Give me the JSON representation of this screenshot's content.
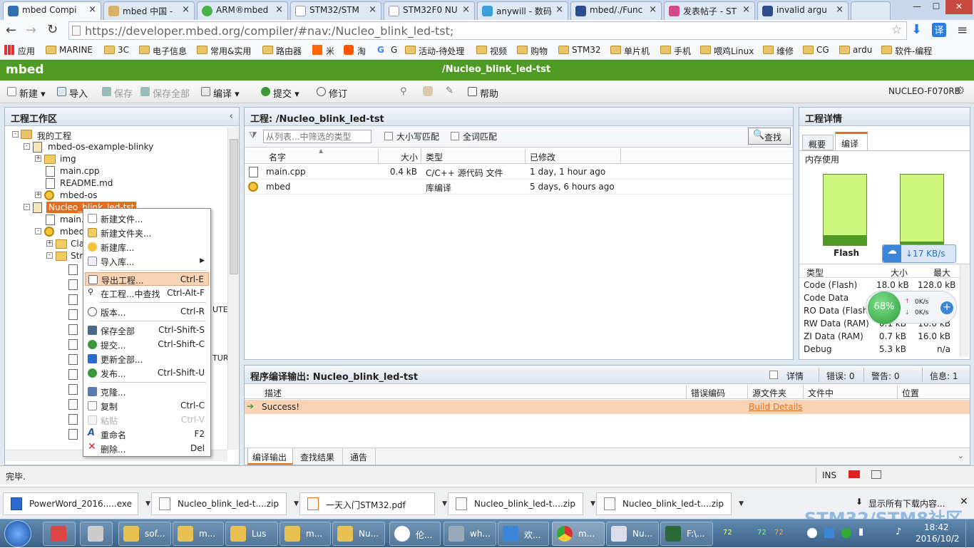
{
  "browser": {
    "tabs": [
      {
        "title": "mbed Compi",
        "color": "#2f6fb3",
        "active": true
      },
      {
        "title": "mbed 中国 -",
        "color": "#d9b26a"
      },
      {
        "title": "ARM®mbed",
        "color": "#49b34a"
      },
      {
        "title": "STM32/STM",
        "color": "#ffffff"
      },
      {
        "title": "STM32F0 NU",
        "color": "#ffffff"
      },
      {
        "title": "anywill - 数码",
        "color": "#3ca0d8"
      },
      {
        "title": "mbed/./Func",
        "color": "#2d4d8e"
      },
      {
        "title": "发表帖子 - ST",
        "color": "#d04a8a"
      },
      {
        "title": "invalid argu",
        "color": "#2d4d8e"
      }
    ],
    "window_controls": [
      "—",
      "☐",
      "✕"
    ],
    "url": "https://developer.mbed.org/compiler/#nav:/Nucleo_blink_led-tst;",
    "bookmarks": [
      "应用",
      "MARINE",
      "3C",
      "电子信息",
      "常用&实用",
      "路由器",
      "米",
      "淘",
      "G",
      "活动-待处理",
      "视频",
      "购物",
      "STM32",
      "单片机",
      "手机",
      "喂鸡Linux",
      "维修",
      "CG",
      "ardu",
      "软件-编程"
    ]
  },
  "app": {
    "logo": "mbed",
    "title": "/Nucleo_blink_led-tst",
    "platform": "NUCLEO-F070RB",
    "toolbar": {
      "new": "新建",
      "import": "导入",
      "save": "保存",
      "save_all": "保存全部",
      "compile": "编译",
      "commit": "提交",
      "revise": "修订",
      "help": "帮助"
    }
  },
  "workspace": {
    "title": "工程工作区",
    "collapse_glyph": "‹",
    "tree": {
      "root": "我的工程",
      "project1": "mbed-os-example-blinky",
      "img": "img",
      "main_cpp": "main.cpp",
      "readme": "README.md",
      "mbed_os": "mbed-os",
      "project2": "Nucleo_blink_led-tst",
      "main_cpp2": "main.cpp",
      "mbed": "mbed",
      "cla": "Cla",
      "stru": "Stru",
      "frag1": "UTES",
      "frag2": "TURE"
    }
  },
  "context_menu": {
    "items": [
      {
        "label": "新建文件...",
        "shortcut": ""
      },
      {
        "label": "新建文件夹...",
        "shortcut": ""
      },
      {
        "label": "新建库...",
        "shortcut": ""
      },
      {
        "label": "导入库...",
        "shortcut": "▶"
      },
      {
        "label": "导出工程...",
        "shortcut": "Ctrl-E"
      },
      {
        "label": "在工程...中查找",
        "shortcut": "Ctrl-Alt-F"
      },
      {
        "label": "版本...",
        "shortcut": "Ctrl-R"
      },
      {
        "label": "保存全部",
        "shortcut": "Ctrl-Shift-S"
      },
      {
        "label": "提交...",
        "shortcut": "Ctrl-Shift-C"
      },
      {
        "label": "更新全部...",
        "shortcut": ""
      },
      {
        "label": "发布...",
        "shortcut": "Ctrl-Shift-U"
      },
      {
        "label": "克隆...",
        "shortcut": ""
      },
      {
        "label": "复制",
        "shortcut": "Ctrl-C"
      },
      {
        "label": "粘贴",
        "shortcut": "Ctrl-V"
      },
      {
        "label": "重命名",
        "shortcut": "F2"
      },
      {
        "label": "删除...",
        "shortcut": "Del"
      }
    ]
  },
  "project_panel": {
    "title": "工程: /Nucleo_blink_led-tst",
    "filter_placeholder": "从列表...中筛选的类型",
    "case_match": "大小写匹配",
    "word_match": "全词匹配",
    "search": "查找",
    "columns": [
      "名字",
      "大小",
      "类型",
      "已修改"
    ],
    "files": [
      {
        "name": "main.cpp",
        "size": "0.4 kB",
        "type": "C/C++ 源代码 文件",
        "modified": "1 day, 1 hour ago"
      },
      {
        "name": "mbed",
        "size": "",
        "type": "库编译",
        "modified": "5 days, 6 hours ago"
      }
    ]
  },
  "output_panel": {
    "title": "程序编译输出: Nucleo_blink_led-tst",
    "details": "详情",
    "errors": "错误: 0",
    "warnings": "警告: 0",
    "info": "信息: 1",
    "columns": [
      "描述",
      "错误编码",
      "源文件夹",
      "文件中",
      "位置"
    ],
    "row": {
      "desc": "Success!",
      "link": "Build Details"
    },
    "tabs": [
      "编译输出",
      "查找结果",
      "通告"
    ]
  },
  "details_panel": {
    "title": "工程详情",
    "tabs": [
      "概要",
      "编译"
    ],
    "memory_label": "内存使用",
    "flash_label": "Flash",
    "flash_used_fraction": 0.14,
    "ram_used_fraction": 0.05,
    "columns": [
      "类型",
      "大小",
      "最大"
    ],
    "rows": [
      {
        "type": "Code (Flash)",
        "size": "18.0 kB",
        "max": "128.0 kB"
      },
      {
        "type": "Code Data",
        "size": "",
        "max": ""
      },
      {
        "type": "RO Data (Flash)",
        "size": "",
        "max": ""
      },
      {
        "type": "RW Data (RAM)",
        "size": "0.1 kB",
        "max": "16.0 kB"
      },
      {
        "type": "ZI Data (RAM)",
        "size": "0.7 kB",
        "max": "16.0 kB"
      },
      {
        "type": "Debug",
        "size": "5.3 kB",
        "max": "n/a"
      }
    ]
  },
  "overlay": {
    "speed": "↓17 KB/s",
    "percent": "68%",
    "up": "0K/s",
    "down": "0K/s"
  },
  "status_bar": {
    "text": "完毕.",
    "ins": "INS"
  },
  "downloads": {
    "items": [
      "PowerWord_2016.....exe",
      "Nucleo_blink_led-t....zip",
      "一天入门STM32.pdf",
      "Nucleo_blink_led-t....zip",
      "Nucleo_blink_led-t....zip"
    ],
    "show_all": "显示所有下载内容..."
  },
  "watermark": "STM32/STM8社区",
  "taskbar": {
    "items": [
      "sof...",
      "m...",
      "Lus",
      "m...",
      "Nu...",
      "伦...",
      "wh...",
      "欢...",
      "m...",
      "Nu...",
      "F:\\..."
    ],
    "tray_nums": [
      "72",
      "72",
      "72"
    ],
    "time": "18:42",
    "date": "2016/10/2"
  }
}
